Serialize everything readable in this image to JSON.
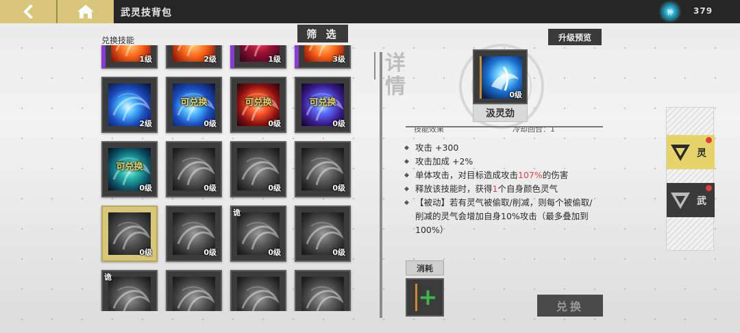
{
  "header": {
    "title": "武灵技背包",
    "currency_value": "379",
    "currency_icon_text": "钟"
  },
  "left_panel": {
    "section_label": "兑换技能",
    "filter_label": "筛 选",
    "tiles": [
      {
        "row": 0,
        "col": 0,
        "level": "1级",
        "exch": "",
        "tag": "",
        "theme": "fire",
        "frame": "purple",
        "selected": false
      },
      {
        "row": 0,
        "col": 1,
        "level": "2级",
        "exch": "",
        "tag": "",
        "theme": "fire",
        "frame": "",
        "selected": false
      },
      {
        "row": 0,
        "col": 2,
        "level": "1级",
        "exch": "",
        "tag": "",
        "theme": "redpurple",
        "frame": "purple",
        "selected": false
      },
      {
        "row": 0,
        "col": 3,
        "level": "3级",
        "exch": "",
        "tag": "",
        "theme": "fire",
        "frame": "purple",
        "selected": false
      },
      {
        "row": 1,
        "col": 0,
        "level": "2级",
        "exch": "",
        "tag": "",
        "theme": "blue",
        "frame": "",
        "selected": false
      },
      {
        "row": 1,
        "col": 1,
        "level": "0级",
        "exch": "可兑换",
        "tag": "",
        "theme": "blue",
        "frame": "",
        "selected": false
      },
      {
        "row": 1,
        "col": 2,
        "level": "0级",
        "exch": "可兑换",
        "tag": "",
        "theme": "red",
        "frame": "",
        "selected": false
      },
      {
        "row": 1,
        "col": 3,
        "level": "0级",
        "exch": "可兑换",
        "tag": "",
        "theme": "purpleblue",
        "frame": "",
        "selected": false
      },
      {
        "row": 2,
        "col": 0,
        "level": "0级",
        "exch": "可兑换",
        "tag": "",
        "theme": "teal",
        "frame": "",
        "selected": false
      },
      {
        "row": 2,
        "col": 1,
        "level": "0级",
        "exch": "",
        "tag": "",
        "theme": "grey",
        "frame": "",
        "selected": false
      },
      {
        "row": 2,
        "col": 2,
        "level": "0级",
        "exch": "",
        "tag": "",
        "theme": "grey",
        "frame": "",
        "selected": false
      },
      {
        "row": 2,
        "col": 3,
        "level": "0级",
        "exch": "",
        "tag": "",
        "theme": "grey",
        "frame": "",
        "selected": false
      },
      {
        "row": 3,
        "col": 0,
        "level": "0级",
        "exch": "",
        "tag": "",
        "theme": "grey",
        "frame": "",
        "selected": true
      },
      {
        "row": 3,
        "col": 1,
        "level": "0级",
        "exch": "",
        "tag": "",
        "theme": "grey",
        "frame": "",
        "selected": false
      },
      {
        "row": 3,
        "col": 2,
        "level": "0级",
        "exch": "",
        "tag": "诡",
        "theme": "grey",
        "frame": "",
        "selected": false
      },
      {
        "row": 3,
        "col": 3,
        "level": "0级",
        "exch": "",
        "tag": "",
        "theme": "grey",
        "frame": "",
        "selected": false
      },
      {
        "row": 4,
        "col": 0,
        "level": "",
        "exch": "",
        "tag": "诡",
        "theme": "grey",
        "frame": "",
        "selected": false
      },
      {
        "row": 4,
        "col": 1,
        "level": "",
        "exch": "",
        "tag": "",
        "theme": "grey",
        "frame": "",
        "selected": false
      },
      {
        "row": 4,
        "col": 2,
        "level": "",
        "exch": "",
        "tag": "",
        "theme": "grey",
        "frame": "",
        "selected": false
      },
      {
        "row": 4,
        "col": 3,
        "level": "",
        "exch": "",
        "tag": "",
        "theme": "grey",
        "frame": "",
        "selected": false
      }
    ]
  },
  "detail": {
    "section_title": "详情",
    "upgrade_preview_label": "升级预览",
    "skill_level": "0级",
    "skill_name": "汲灵劲",
    "effect_header": "技能效果",
    "cooldown_text": "冷却回合：1",
    "effects": [
      {
        "parts": [
          {
            "t": "攻击 +300",
            "red": false
          }
        ]
      },
      {
        "parts": [
          {
            "t": "攻击加成 +2%",
            "red": false
          }
        ]
      },
      {
        "parts": [
          {
            "t": "单体攻击，对目标造成攻击",
            "red": false
          },
          {
            "t": "107%",
            "red": true
          },
          {
            "t": "的伤害",
            "red": false
          }
        ]
      },
      {
        "parts": [
          {
            "t": "释放该技能时，获得",
            "red": false
          },
          {
            "t": "1",
            "red": true
          },
          {
            "t": "个自身颜色灵气",
            "red": false
          }
        ]
      },
      {
        "parts": [
          {
            "t": "【被动】若有灵气被偷取/削减，则每个被偷取/削减的灵气会增加自身10%攻击（最多叠加到100%）",
            "red": false
          }
        ]
      }
    ],
    "consume_label": "消耗",
    "add_symbol": "+",
    "exchange_label": "兑换"
  },
  "side_tabs": [
    {
      "label": "灵",
      "active": true
    },
    {
      "label": "武",
      "active": false
    }
  ],
  "colors": {
    "accent_gold": "#d8c77a",
    "highlight_red": "#e0414a",
    "plus_green": "#3fb54a"
  }
}
